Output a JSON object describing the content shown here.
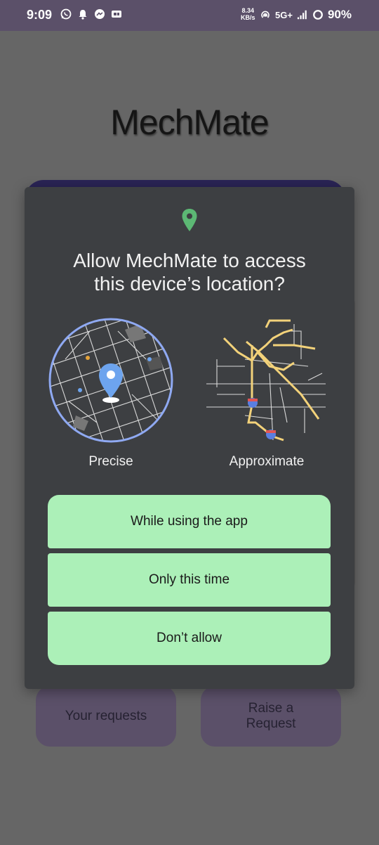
{
  "status_bar": {
    "time": "9:09",
    "speed_value": "8.34",
    "speed_unit": "KB/s",
    "network": "5G+",
    "battery": "90%",
    "icons": [
      "whatsapp-icon",
      "notification-bell-icon",
      "messenger-icon",
      "sim-card-icon",
      "hotspot-icon",
      "signal-icon",
      "battery-ring-icon"
    ]
  },
  "app": {
    "title": "MechMate",
    "your_requests": "Your requests",
    "raise_request": "Raise a\nRequest"
  },
  "dialog": {
    "title": "Allow MechMate to access\nthis device’s location?",
    "precise_label": "Precise",
    "approximate_label": "Approximate",
    "options": [
      "While using the app",
      "Only this time",
      "Don’t allow"
    ],
    "accent_color": "#acf0b8",
    "pin_color": "#5cb874"
  }
}
